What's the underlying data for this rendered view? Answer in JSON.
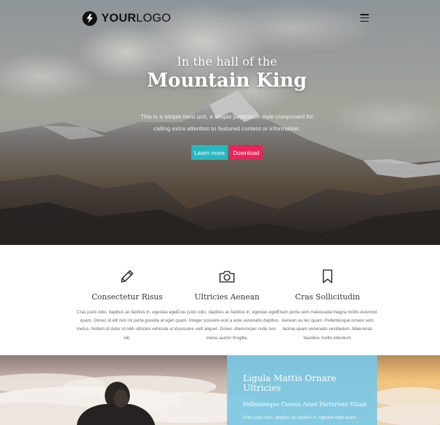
{
  "header": {
    "logo_bold": "YOUR",
    "logo_light": "LOGO",
    "menu_icon": "hamburger-menu-icon"
  },
  "hero": {
    "subtitle": "In the hall of the",
    "title": "Mountain King",
    "description": "This is a simple hero unit, a simple jumbotron-style component for calling extra attention to featured content or information.",
    "learn_more": "Learn more",
    "download": "Download"
  },
  "features": [
    {
      "icon": "pencil-icon",
      "title": "Consectetur Risus",
      "text": "Cras justo odio, dapibus ac facilisis in, egestas eget quam. Donec id elit non mi porta gravida at eget metus. Nullam id dolor id nibh ultricies vehicula ut id elit."
    },
    {
      "icon": "camera-icon",
      "title": "Ultricies Aenean",
      "text": "Cras justo odio, dapibus ac facilisis in, egestas eget quam. Integer posuere erat a ante venenatis dapibus posuere velit aliquet. Donec ullamcorper nulla non metus auctor fringilla."
    },
    {
      "icon": "bookmark-icon",
      "title": "Cras Sollicitudin",
      "text": "Etiam porta sem malesuada magna mollis euismod. Aenean eu leo quam. Pellentesque ornare sem lacinia quam venenatis vestibulum. Maecenas faucibus mollis interdum."
    }
  ],
  "bottom": {
    "title": "Ligula Mattis Ornare Ultricies",
    "subtitle": "Pellentesque Cursus Amet Parturient Etiam",
    "text": "Cras justo odio, dapibus ac facilisis in, egestas eget quam."
  },
  "colors": {
    "learn_more": "#27b8c2",
    "download": "#e8245a",
    "panel": "#7cc8e2"
  }
}
